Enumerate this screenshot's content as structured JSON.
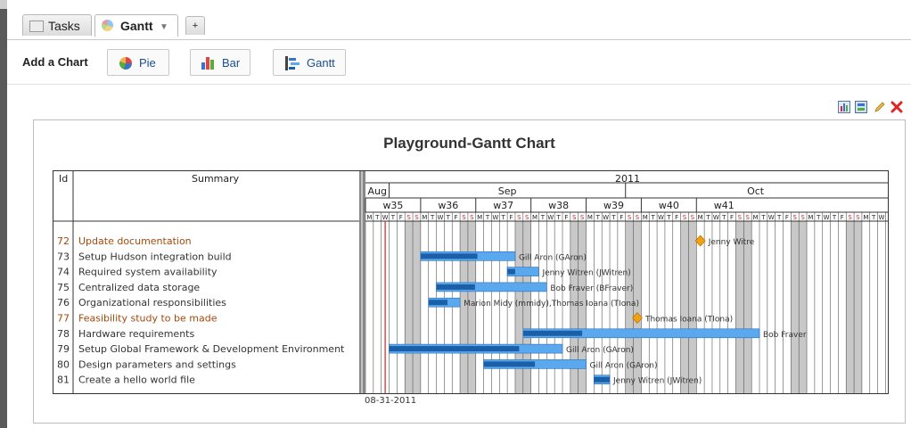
{
  "tabs": [
    {
      "label": "Tasks",
      "icon": "tasks-icon"
    },
    {
      "label": "Gantt",
      "icon": "gantt-chart-icon",
      "active": true
    },
    {
      "label": "+"
    }
  ],
  "toolbar": {
    "add_label": "Add a Chart",
    "buttons": [
      {
        "label": "Pie",
        "icon": "pie-chart-icon"
      },
      {
        "label": "Bar",
        "icon": "bar-chart-icon"
      },
      {
        "label": "Gantt",
        "icon": "gantt-chart-icon"
      }
    ]
  },
  "chart_tools": [
    "chart-settings-icon",
    "chart-refresh-icon",
    "edit-pencil-icon",
    "delete-icon"
  ],
  "colors": {
    "bar_light": "#5aa9ee",
    "bar_dark": "#1a5fa8",
    "milestone": "#f2a20f",
    "today": "#d81e1e",
    "weekend": "#c8c8c8",
    "milestone_text": "#a54a0d"
  },
  "chart_data": {
    "type": "gantt",
    "title": "Playground-Gantt Chart",
    "columns": {
      "id": "Id",
      "summary": "Summary"
    },
    "year": "2011",
    "months": [
      "Aug",
      "Sep",
      "Oct"
    ],
    "weeks": [
      "w35",
      "w36",
      "w37",
      "w38",
      "w39",
      "w40",
      "w41"
    ],
    "weekdays": [
      "M",
      "T",
      "W",
      "T",
      "F",
      "S",
      "S"
    ],
    "today": "08-31-2011",
    "date_caption": "08-31-2011",
    "tasks": [
      {
        "id": "72",
        "name": "Update documentation",
        "milestone": true,
        "date": "2011-10-10",
        "resource": "Jenny Witre"
      },
      {
        "id": "73",
        "name": "Setup Hudson integration build",
        "start": "2011-09-05",
        "end": "2011-09-16",
        "progress": 0.6,
        "resource": "Gill Aron (GAron)"
      },
      {
        "id": "74",
        "name": "Required system availability",
        "start": "2011-09-16",
        "end": "2011-09-19",
        "progress": 0.25,
        "resource": "Jenny Witren (JWitren)"
      },
      {
        "id": "75",
        "name": "Centralized data storage",
        "start": "2011-09-07",
        "end": "2011-09-20",
        "progress": 0.35,
        "resource": "Bob Fraver (BFraver)"
      },
      {
        "id": "76",
        "name": "Organizational responsibilities",
        "start": "2011-09-06",
        "end": "2011-09-09",
        "progress": 0.6,
        "resource": "Marion Midy (mmidy),Thomas Ioana (TIona)"
      },
      {
        "id": "77",
        "name": "Feasibility study to be made",
        "milestone": true,
        "date": "2011-10-02",
        "resource": "Thomas Ioana (TIona)"
      },
      {
        "id": "78",
        "name": "Hardware requirements",
        "start": "2011-09-18",
        "end": "2011-10-17",
        "progress": 0.25,
        "resource": "Bob Fraver"
      },
      {
        "id": "79",
        "name": "Setup Global Framework & Development Environment",
        "start": "2011-09-01",
        "end": "2011-09-22",
        "progress": 0.75,
        "resource": "Gill Aron (GAron)"
      },
      {
        "id": "80",
        "name": "Design parameters and settings",
        "start": "2011-09-13",
        "end": "2011-09-25",
        "progress": 0.5,
        "resource": "Gill Aron (GAron)"
      },
      {
        "id": "81",
        "name": "Create a hello world file",
        "start": "2011-09-27",
        "end": "2011-09-28",
        "progress": 1.0,
        "resource": "Jenny Witren (JWitren)"
      }
    ]
  }
}
